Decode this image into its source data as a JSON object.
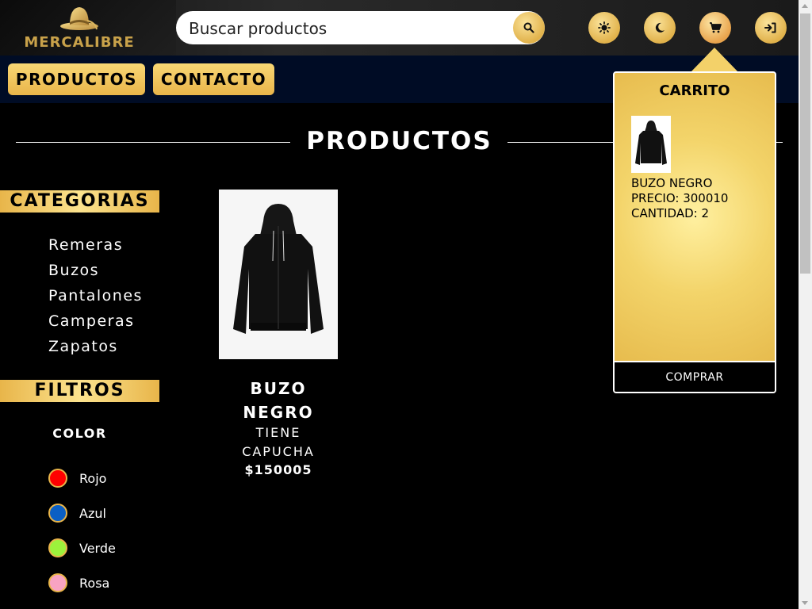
{
  "header": {
    "logo_text": "MERCALIBRE",
    "search": {
      "placeholder": "Buscar productos",
      "icon": "search-icon"
    },
    "buttons": [
      {
        "icon": "sun-icon"
      },
      {
        "icon": "moon-icon"
      },
      {
        "icon": "cart-icon"
      },
      {
        "icon": "login-icon"
      }
    ]
  },
  "nav": {
    "productos": "PRODUCTOS",
    "contacto": "CONTACTO"
  },
  "page": {
    "title": "PRODUCTOS"
  },
  "sidebar": {
    "categories_title": "CATEGORIAS",
    "categories": [
      "Remeras",
      "Buzos",
      "Pantalones",
      "Camperas",
      "Zapatos"
    ],
    "filters_title": "FILTROS",
    "color_title": "COLOR",
    "colors": [
      {
        "label": "Rojo",
        "color": "#ff0000"
      },
      {
        "label": "Azul",
        "color": "#0a5fc4"
      },
      {
        "label": "Verde",
        "color": "#9cf23c"
      },
      {
        "label": "Rosa",
        "color": "#f8a3c2"
      }
    ]
  },
  "product": {
    "name": "BUZO NEGRO",
    "description": "TIENE CAPUCHA",
    "price": "$150005",
    "image": "black-hoodie"
  },
  "cart": {
    "title": "CARRITO",
    "item_name": "BUZO NEGRO",
    "item_price": "PRECIO: 300010",
    "item_quantity": "CANTIDAD: 2",
    "buy_label": "COMPRAR"
  },
  "colors": {
    "gold": "#e9b54a",
    "nav_bg": "#000c25",
    "background": "#000000"
  }
}
